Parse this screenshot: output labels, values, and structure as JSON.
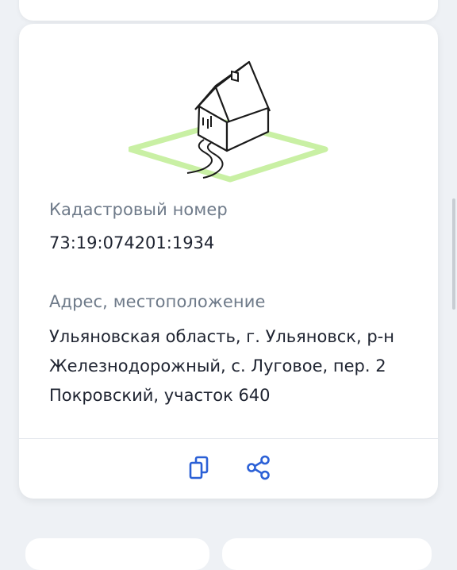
{
  "object": {
    "cadastral": {
      "label": "Кадастровый номер",
      "value": "73:19:074201:1934"
    },
    "address": {
      "label": "Адрес, местоположение",
      "lines": [
        "Ульяновская область, г. Ульяновск, р-н",
        "Железнодорожный, с. Луговое, пер. 2",
        "Покровский, участок 640"
      ]
    }
  },
  "icons": {
    "illustration": "house-plot-icon",
    "copy": "copy-icon",
    "share": "share-icon",
    "accent_color": "#2b60d6",
    "plot_color": "#c9f0a4"
  }
}
